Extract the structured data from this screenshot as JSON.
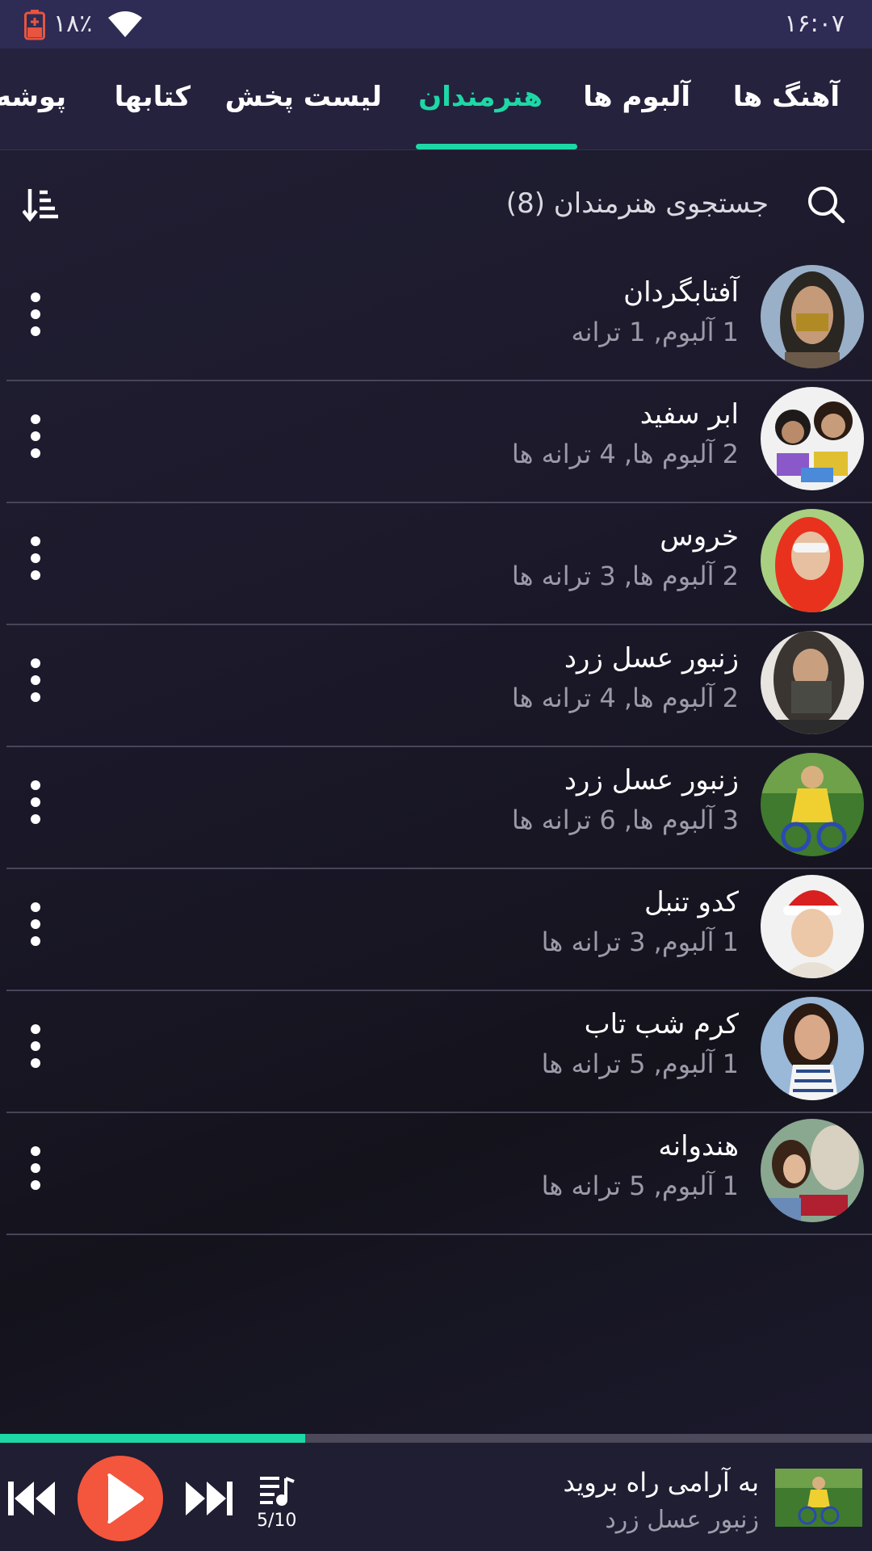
{
  "status_bar": {
    "battery_level": "١٨٪",
    "time": "١۶:٠٧",
    "battery_icon": "battery-low-icon",
    "wifi_icon": "wifi-icon"
  },
  "tabs": [
    {
      "label": "آهنگ ها",
      "active": false
    },
    {
      "label": "آلبوم ها",
      "active": false
    },
    {
      "label": "هنرمندان",
      "active": true
    },
    {
      "label": "لیست پخش",
      "active": false
    },
    {
      "label": "کتابها",
      "active": false
    },
    {
      "label": "پوشه ه",
      "active": false
    }
  ],
  "search": {
    "placeholder": "جستجوی هنرمندان (8)"
  },
  "artists": [
    {
      "name": "آفتابگردان",
      "info": "1 آلبوم, 1 ترانه"
    },
    {
      "name": "ابر سفید",
      "info": "2 آلبوم ها, 4 ترانه ها"
    },
    {
      "name": "خروس",
      "info": "2 آلبوم ها, 3 ترانه ها"
    },
    {
      "name": "زنبور عسل زرد",
      "info": "2 آلبوم ها, 4 ترانه ها"
    },
    {
      "name": "زنبور عسل زرد",
      "info": "3 آلبوم ها, 6 ترانه ها"
    },
    {
      "name": "کدو تنبل",
      "info": "1 آلبوم, 3 ترانه ها"
    },
    {
      "name": "کرم شب تاب",
      "info": "1 آلبوم, 5 ترانه ها"
    },
    {
      "name": "هندوانه",
      "info": "1 آلبوم, 5 ترانه ها"
    }
  ],
  "now_playing": {
    "title": "به آرامی راه بروید",
    "artist": "زنبور عسل زرد",
    "queue": "5/10",
    "progress_fraction": 0.35
  },
  "colors": {
    "accent": "#1dd8a6",
    "play_button": "#f4553d",
    "status_bar": "#2e2b55",
    "tab_bar": "#25223d"
  }
}
